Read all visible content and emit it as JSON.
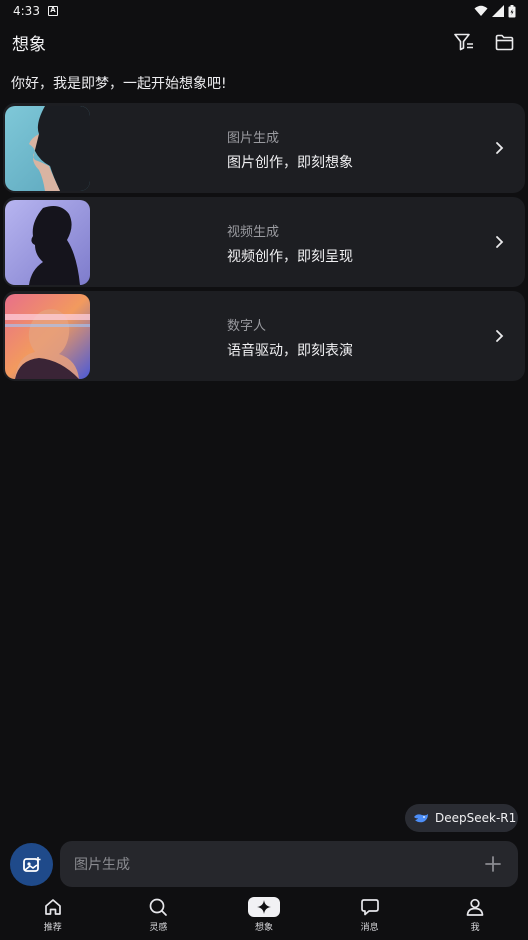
{
  "status_bar": {
    "time": "4:33",
    "notification_icon": "a-box-icon"
  },
  "header": {
    "title": "想象",
    "icons": [
      "filter-icon",
      "folder-icon"
    ]
  },
  "greeting": "你好，我是即梦，一起开始想象吧!",
  "cards": [
    {
      "title": "图片生成",
      "subtitle": "图片创作，即刻想象",
      "thumb": "portrait-teal"
    },
    {
      "title": "视频生成",
      "subtitle": "视频创作，即刻呈现",
      "thumb": "portrait-purple"
    },
    {
      "title": "数字人",
      "subtitle": "语音驱动，即刻表演",
      "thumb": "portrait-neon"
    }
  ],
  "model_chip": {
    "label": "DeepSeek-R1",
    "icon": "whale-icon"
  },
  "prompt": {
    "placeholder": "图片生成"
  },
  "tabs": [
    {
      "label": "推荐",
      "icon": "home-icon"
    },
    {
      "label": "灵感",
      "icon": "search-icon"
    },
    {
      "label": "想象",
      "icon": "sparkle-icon",
      "active": true
    },
    {
      "label": "消息",
      "icon": "chat-icon"
    },
    {
      "label": "我",
      "icon": "person-icon"
    }
  ],
  "colors": {
    "background": "#0f0f11",
    "card": "#1d1e22",
    "accent": "#1f4a8a"
  }
}
